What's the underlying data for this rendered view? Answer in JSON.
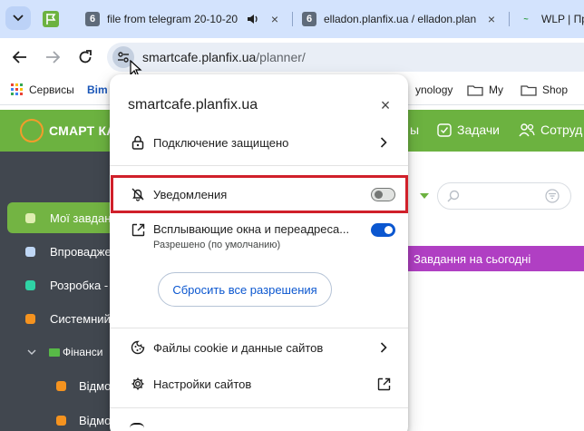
{
  "tabs": [
    {
      "favicon": "6",
      "title": "file from telegram 20-10-20",
      "has_audio": true
    },
    {
      "favicon": "6",
      "title": "elladon.planfix.ua / elladon.plan"
    },
    {
      "favicon": "WLP",
      "title": "WLP | Про"
    }
  ],
  "browser": {
    "url_host": "smartcafe.planfix.ua",
    "url_path": "/planner/"
  },
  "bookmarks": [
    {
      "label": "Сервисы",
      "icon": "apps-grid-icon"
    },
    {
      "label": "Bim",
      "icon": "none"
    },
    {
      "label": "ynology",
      "icon": "none"
    },
    {
      "label": "My",
      "icon": "folder-icon"
    },
    {
      "label": "Shop",
      "icon": "folder-icon"
    }
  ],
  "app": {
    "name": "СМАРТ КА",
    "header_links": [
      "ы",
      "Задачи",
      "Сотруд"
    ],
    "brand_color": "#6cb240"
  },
  "sidebar": {
    "items": [
      {
        "label": "Мої завдан",
        "color": "#dfeeb0",
        "active": true
      },
      {
        "label": "Впровадже",
        "color": "#bfd7f5"
      },
      {
        "label": "Розробка -",
        "color": "#2fd3a5"
      },
      {
        "label": "Системний",
        "color": "#f5931f"
      }
    ],
    "group": {
      "label": "Фінанси"
    },
    "sub_items": [
      "Відмо",
      "Відмо"
    ]
  },
  "main": {
    "today_banner": "Завдання на сьогодні",
    "banner_color": "#b03fc3"
  },
  "popup": {
    "host": "smartcafe.planfix.ua",
    "connection_label": "Подключение защищено",
    "notifications_label": "Уведомления",
    "notifications_enabled": false,
    "popups_label": "Всплывающие окна и переадреса...",
    "popups_sublabel": "Разрешено (по умолчанию)",
    "popups_enabled": true,
    "reset_button": "Сбросить все разрешения",
    "cookies_label": "Файлы cookie и данные сайтов",
    "site_settings_label": "Настройки сайтов",
    "highlight_color": "#d0202a"
  }
}
